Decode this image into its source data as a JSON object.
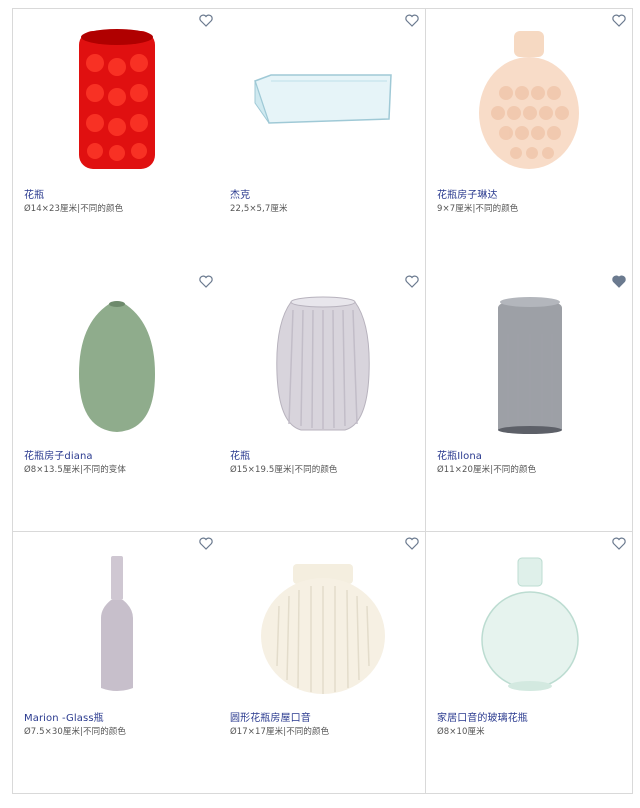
{
  "products": [
    {
      "title": "花瓶",
      "spec": "Ø14×23厘米|不同的颜色",
      "favorited": false,
      "icon": "red-vase-image"
    },
    {
      "title": "杰克",
      "spec": "22,5×5,7厘米",
      "favorited": false,
      "icon": "glass-tray-image"
    },
    {
      "title": "花瓶房子琳达",
      "spec": "9×7厘米|不同的颜色",
      "favorited": false,
      "icon": "peach-vase-image"
    },
    {
      "title": "花瓶房子diana",
      "spec": "Ø8×13.5厘米|不同的变体",
      "favorited": false,
      "icon": "green-vase-image"
    },
    {
      "title": "花瓶",
      "spec": "Ø15×19.5厘米|不同的颜色",
      "favorited": false,
      "icon": "ribbed-glass-vase-image"
    },
    {
      "title": "花瓶Ilona",
      "spec": "Ø11×20厘米|不同的颜色",
      "favorited": true,
      "icon": "grey-glass-vase-image"
    },
    {
      "title": "Marion -Glass瓶",
      "spec": "Ø7.5×30厘米|不同的颜色",
      "favorited": false,
      "icon": "glass-bottle-image"
    },
    {
      "title": "圆形花瓶房屋口音",
      "spec": "Ø17×17厘米|不同的颜色",
      "favorited": false,
      "icon": "round-ribbed-vase-image"
    },
    {
      "title": "家居口音的玻璃花瓶",
      "spec": "Ø8×10厘米",
      "favorited": false,
      "icon": "glass-bulb-vase-image"
    }
  ],
  "colors": {
    "title": "#2a3a8f",
    "heart_outline": "#6b7a8f",
    "heart_filled": "#6b7a8f"
  }
}
